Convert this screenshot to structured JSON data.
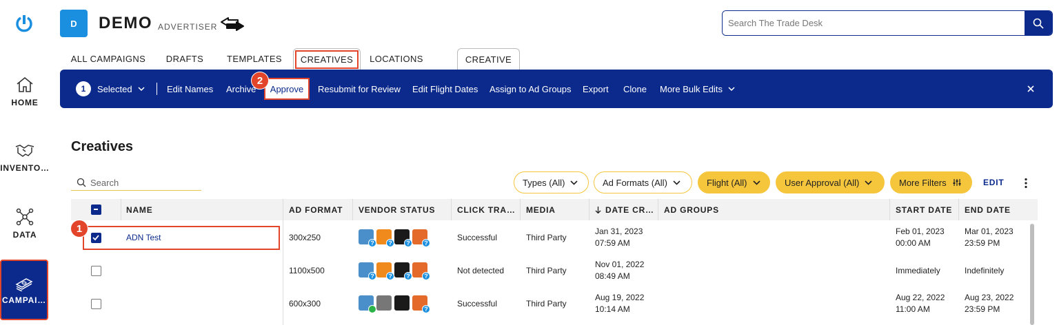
{
  "rail": {
    "home": "HOME",
    "inventory": "INVENTO…",
    "data": "DATA",
    "campaigns": "CAMPAI…"
  },
  "advertiser": {
    "badge": "D",
    "name": "DEMO",
    "type": "ADVERTISER"
  },
  "search": {
    "placeholder": "Search The Trade Desk"
  },
  "tabs": [
    "ALL CAMPAIGNS",
    "DRAFTS",
    "TEMPLATES",
    "CREATIVES",
    "LOCATIONS",
    "CREATIVE"
  ],
  "bulkbar": {
    "count": "1",
    "selected": "Selected",
    "actions": [
      "Edit Names",
      "Archive",
      "Approve",
      "Resubmit for Review",
      "Edit Flight Dates",
      "Assign to Ad Groups",
      "Export",
      "Clone",
      "More Bulk Edits"
    ]
  },
  "annotations": {
    "step1": "1",
    "step2": "2"
  },
  "section": {
    "title": "Creatives",
    "search_placeholder": "Search"
  },
  "filters": [
    "Types (All)",
    "Ad Formats (All)",
    "Flight (All)",
    "User Approval (All)",
    "More Filters"
  ],
  "edit_label": "EDIT",
  "table": {
    "headers": [
      "NAME",
      "AD FORMAT",
      "VENDOR STATUS",
      "CLICK TRA…",
      "MEDIA",
      "DATE CR…",
      "AD GROUPS",
      "START DATE",
      "END DATE"
    ],
    "rows": [
      {
        "name": "ADN Test",
        "format": "300x250",
        "click": "Successful",
        "media": "Third Party",
        "created1": "Jan 31, 2023",
        "created2": "07:59 AM",
        "start1": "Feb 01, 2023",
        "start2": "00:00 AM",
        "end1": "Mar 01, 2023",
        "end2": "23:59 PM"
      },
      {
        "name": "",
        "format": "1100x500",
        "click": "Not detected",
        "media": "Third Party",
        "created1": "Nov 01, 2022",
        "created2": "08:49 AM",
        "start1": "Immediately",
        "start2": "",
        "end1": "Indefinitely",
        "end2": ""
      },
      {
        "name": "",
        "format": "600x300",
        "click": "Successful",
        "media": "Third Party",
        "created1": "Aug 19, 2022",
        "created2": "10:14 AM",
        "start1": "Aug 22, 2022",
        "start2": "11:00 AM",
        "end1": "Aug 23, 2022",
        "end2": "23:59 PM"
      }
    ]
  },
  "colors": {
    "brand": "#0b2a8c",
    "accent": "#f5c53b",
    "highlight": "#e2452a",
    "badge": "#1a8fe0"
  }
}
